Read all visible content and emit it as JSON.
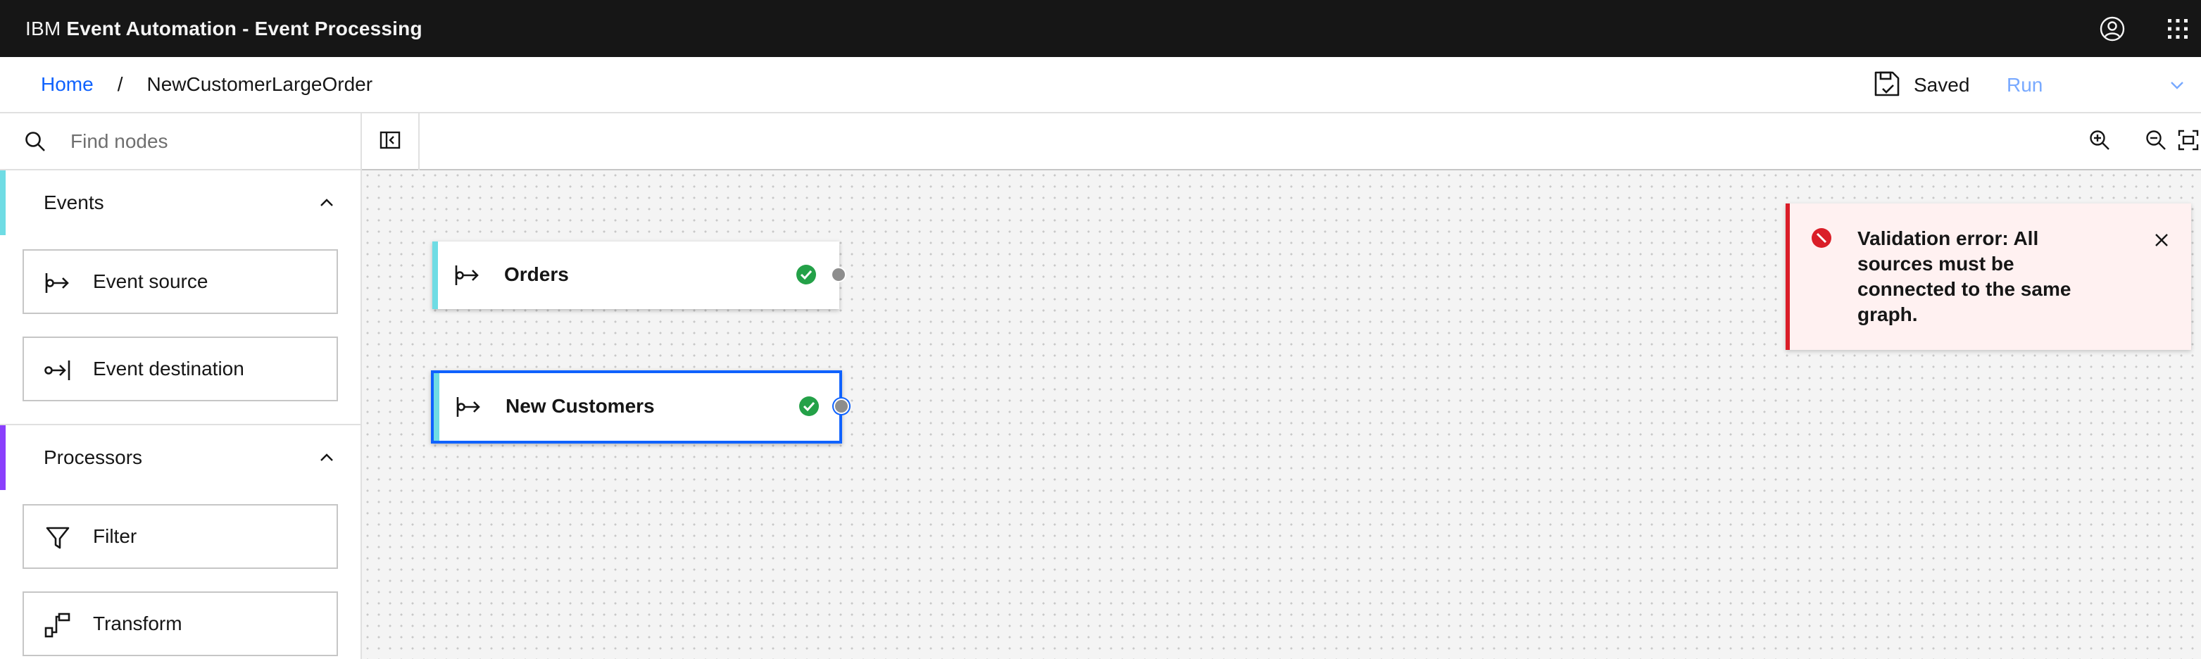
{
  "header": {
    "brand": "IBM",
    "product": "Event Automation - Event Processing",
    "user_icon": "user-avatar-icon",
    "apps_icon": "app-switcher-icon"
  },
  "breadcrumb": {
    "home": "Home",
    "separator": "/",
    "current": "NewCustomerLargeOrder"
  },
  "actions": {
    "saved_label": "Saved",
    "run_label": "Run"
  },
  "sidebar": {
    "search_placeholder": "Find nodes",
    "sections": [
      {
        "title": "Events",
        "accent": "#6fdce4",
        "items": [
          {
            "label": "Event source",
            "icon": "event-source-icon"
          },
          {
            "label": "Event destination",
            "icon": "event-destination-icon"
          }
        ]
      },
      {
        "title": "Processors",
        "accent": "#8a3ffc",
        "items": [
          {
            "label": "Filter",
            "icon": "filter-icon"
          },
          {
            "label": "Transform",
            "icon": "transform-icon"
          }
        ]
      }
    ]
  },
  "canvas": {
    "nodes": [
      {
        "label": "Orders",
        "status": "valid",
        "selected": false
      },
      {
        "label": "New Customers",
        "status": "valid",
        "selected": true
      }
    ]
  },
  "toast": {
    "kind": "error",
    "message": "Validation error: All sources must be connected to the same graph."
  },
  "colors": {
    "link": "#0f62fe",
    "run_disabled": "#78a9ff",
    "success": "#24a148",
    "error": "#da1e28",
    "selection": "#0f62fe"
  }
}
